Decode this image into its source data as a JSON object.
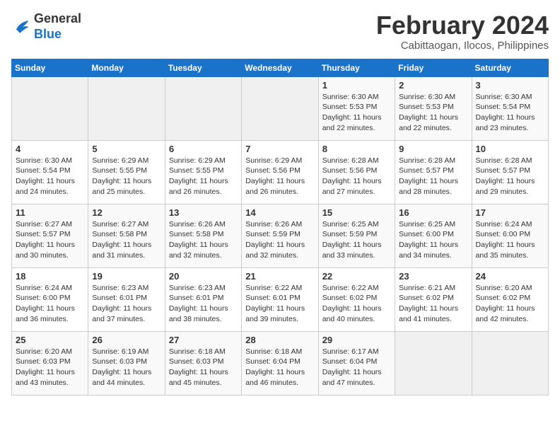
{
  "logo": {
    "line1": "General",
    "line2": "Blue"
  },
  "title": "February 2024",
  "subtitle": "Cabittaogan, Ilocos, Philippines",
  "weekdays": [
    "Sunday",
    "Monday",
    "Tuesday",
    "Wednesday",
    "Thursday",
    "Friday",
    "Saturday"
  ],
  "weeks": [
    [
      {
        "num": "",
        "info": ""
      },
      {
        "num": "",
        "info": ""
      },
      {
        "num": "",
        "info": ""
      },
      {
        "num": "",
        "info": ""
      },
      {
        "num": "1",
        "info": "Sunrise: 6:30 AM\nSunset: 5:53 PM\nDaylight: 11 hours\nand 22 minutes."
      },
      {
        "num": "2",
        "info": "Sunrise: 6:30 AM\nSunset: 5:53 PM\nDaylight: 11 hours\nand 22 minutes."
      },
      {
        "num": "3",
        "info": "Sunrise: 6:30 AM\nSunset: 5:54 PM\nDaylight: 11 hours\nand 23 minutes."
      }
    ],
    [
      {
        "num": "4",
        "info": "Sunrise: 6:30 AM\nSunset: 5:54 PM\nDaylight: 11 hours\nand 24 minutes."
      },
      {
        "num": "5",
        "info": "Sunrise: 6:29 AM\nSunset: 5:55 PM\nDaylight: 11 hours\nand 25 minutes."
      },
      {
        "num": "6",
        "info": "Sunrise: 6:29 AM\nSunset: 5:55 PM\nDaylight: 11 hours\nand 26 minutes."
      },
      {
        "num": "7",
        "info": "Sunrise: 6:29 AM\nSunset: 5:56 PM\nDaylight: 11 hours\nand 26 minutes."
      },
      {
        "num": "8",
        "info": "Sunrise: 6:28 AM\nSunset: 5:56 PM\nDaylight: 11 hours\nand 27 minutes."
      },
      {
        "num": "9",
        "info": "Sunrise: 6:28 AM\nSunset: 5:57 PM\nDaylight: 11 hours\nand 28 minutes."
      },
      {
        "num": "10",
        "info": "Sunrise: 6:28 AM\nSunset: 5:57 PM\nDaylight: 11 hours\nand 29 minutes."
      }
    ],
    [
      {
        "num": "11",
        "info": "Sunrise: 6:27 AM\nSunset: 5:57 PM\nDaylight: 11 hours\nand 30 minutes."
      },
      {
        "num": "12",
        "info": "Sunrise: 6:27 AM\nSunset: 5:58 PM\nDaylight: 11 hours\nand 31 minutes."
      },
      {
        "num": "13",
        "info": "Sunrise: 6:26 AM\nSunset: 5:58 PM\nDaylight: 11 hours\nand 32 minutes."
      },
      {
        "num": "14",
        "info": "Sunrise: 6:26 AM\nSunset: 5:59 PM\nDaylight: 11 hours\nand 32 minutes."
      },
      {
        "num": "15",
        "info": "Sunrise: 6:25 AM\nSunset: 5:59 PM\nDaylight: 11 hours\nand 33 minutes."
      },
      {
        "num": "16",
        "info": "Sunrise: 6:25 AM\nSunset: 6:00 PM\nDaylight: 11 hours\nand 34 minutes."
      },
      {
        "num": "17",
        "info": "Sunrise: 6:24 AM\nSunset: 6:00 PM\nDaylight: 11 hours\nand 35 minutes."
      }
    ],
    [
      {
        "num": "18",
        "info": "Sunrise: 6:24 AM\nSunset: 6:00 PM\nDaylight: 11 hours\nand 36 minutes."
      },
      {
        "num": "19",
        "info": "Sunrise: 6:23 AM\nSunset: 6:01 PM\nDaylight: 11 hours\nand 37 minutes."
      },
      {
        "num": "20",
        "info": "Sunrise: 6:23 AM\nSunset: 6:01 PM\nDaylight: 11 hours\nand 38 minutes."
      },
      {
        "num": "21",
        "info": "Sunrise: 6:22 AM\nSunset: 6:01 PM\nDaylight: 11 hours\nand 39 minutes."
      },
      {
        "num": "22",
        "info": "Sunrise: 6:22 AM\nSunset: 6:02 PM\nDaylight: 11 hours\nand 40 minutes."
      },
      {
        "num": "23",
        "info": "Sunrise: 6:21 AM\nSunset: 6:02 PM\nDaylight: 11 hours\nand 41 minutes."
      },
      {
        "num": "24",
        "info": "Sunrise: 6:20 AM\nSunset: 6:02 PM\nDaylight: 11 hours\nand 42 minutes."
      }
    ],
    [
      {
        "num": "25",
        "info": "Sunrise: 6:20 AM\nSunset: 6:03 PM\nDaylight: 11 hours\nand 43 minutes."
      },
      {
        "num": "26",
        "info": "Sunrise: 6:19 AM\nSunset: 6:03 PM\nDaylight: 11 hours\nand 44 minutes."
      },
      {
        "num": "27",
        "info": "Sunrise: 6:18 AM\nSunset: 6:03 PM\nDaylight: 11 hours\nand 45 minutes."
      },
      {
        "num": "28",
        "info": "Sunrise: 6:18 AM\nSunset: 6:04 PM\nDaylight: 11 hours\nand 46 minutes."
      },
      {
        "num": "29",
        "info": "Sunrise: 6:17 AM\nSunset: 6:04 PM\nDaylight: 11 hours\nand 47 minutes."
      },
      {
        "num": "",
        "info": ""
      },
      {
        "num": "",
        "info": ""
      }
    ]
  ]
}
